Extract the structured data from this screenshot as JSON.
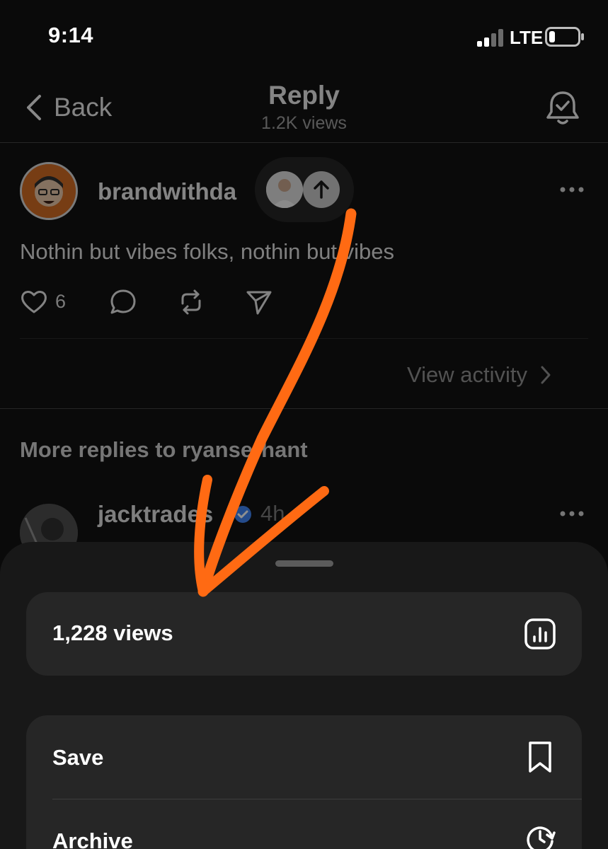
{
  "status_bar": {
    "time": "9:14",
    "network": "LTE"
  },
  "nav": {
    "back_label": "Back",
    "title": "Reply",
    "subtitle": "1.2K views"
  },
  "post": {
    "username": "brandwithda",
    "text": "Nothin but vibes folks, nothin but vibes",
    "like_count": "6",
    "view_activity": "View activity"
  },
  "more_replies": {
    "title": "More replies to ryanserhant",
    "first_reply": {
      "username": "jacktrades",
      "time": "4h"
    }
  },
  "sheet": {
    "views_label": "1,228 views",
    "options": [
      {
        "label": "Save",
        "icon": "bookmark-icon"
      },
      {
        "label": "Archive",
        "icon": "archive-clock-icon"
      }
    ]
  },
  "colors": {
    "annotation_arrow": "#ff6a13",
    "sheet_bg": "#181818",
    "card_bg": "#262626"
  }
}
